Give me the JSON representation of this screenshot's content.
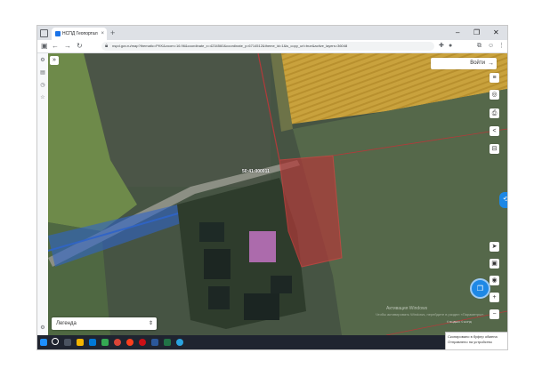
{
  "browser": {
    "tab_title": "НСПД Геопортал: выписка п.",
    "tab_close": "×",
    "new_tab": "+",
    "window_controls": {
      "minimize": "–",
      "restore": "❐",
      "close": "✕"
    },
    "nav": {
      "back": "←",
      "forward": "→",
      "reload": "↻"
    },
    "url": "nspd.gov.ru/map?thematic=PKK&zoom=16.96&coordinate_x=4234560&coordinate_y=6714512&theme_id=1&is_copy_url=true&active_layers=36048"
  },
  "sidebar_icons": [
    "gear-icon",
    "document-icon",
    "history-icon",
    "star-icon"
  ],
  "map": {
    "login_label": "Войти",
    "login_icon": "→",
    "collapse_icon": "»",
    "parcel_label": "50:41:000011",
    "watermark_line1": "Активация Windows",
    "watermark_line2": "Чтобы активировать Windows, перейдите в раздел «Параметры».",
    "copyright": "© ЯНДЕКС © НСПД",
    "legend_label": "Легенда",
    "legend_arrow": "⇕",
    "right_controls": [
      {
        "name": "layers-button",
        "icon": "≡"
      },
      {
        "name": "basemap-button",
        "icon": "◎"
      },
      {
        "name": "print-button",
        "icon": "⎙"
      },
      {
        "name": "share-button",
        "icon": "<"
      },
      {
        "name": "save-button",
        "icon": "⊟"
      }
    ],
    "lower_controls": [
      {
        "name": "locate-button",
        "icon": "➤"
      },
      {
        "name": "measure-button",
        "icon": "▣"
      },
      {
        "name": "geo-button",
        "icon": "◉"
      },
      {
        "name": "zoom-in-button",
        "icon": "+"
      },
      {
        "name": "zoom-out-button",
        "icon": "−"
      }
    ],
    "chat_icon": "❐",
    "edge_icon": "⟲"
  },
  "taskbar": {
    "apps": [
      "windows-start-icon",
      "search-icon",
      "task-view-icon",
      "file-explorer-icon",
      "store-icon",
      "mail-icon",
      "chrome-icon",
      "yandex-icon",
      "opera-icon",
      "word-icon",
      "excel-icon",
      "telegram-icon"
    ],
    "tray_text": "^ ⌂ ▭ ⁐"
  },
  "notification": {
    "line1": "Скопировано в буфер обмена",
    "line2": "Отправлено на устройство"
  },
  "colors": {
    "parcel_fill": "#b23a3a",
    "parcel_outline": "#e04040",
    "road_blue": "#2f64c8",
    "pink_parcel": "#d77bd7",
    "accent": "#1e88e5"
  }
}
